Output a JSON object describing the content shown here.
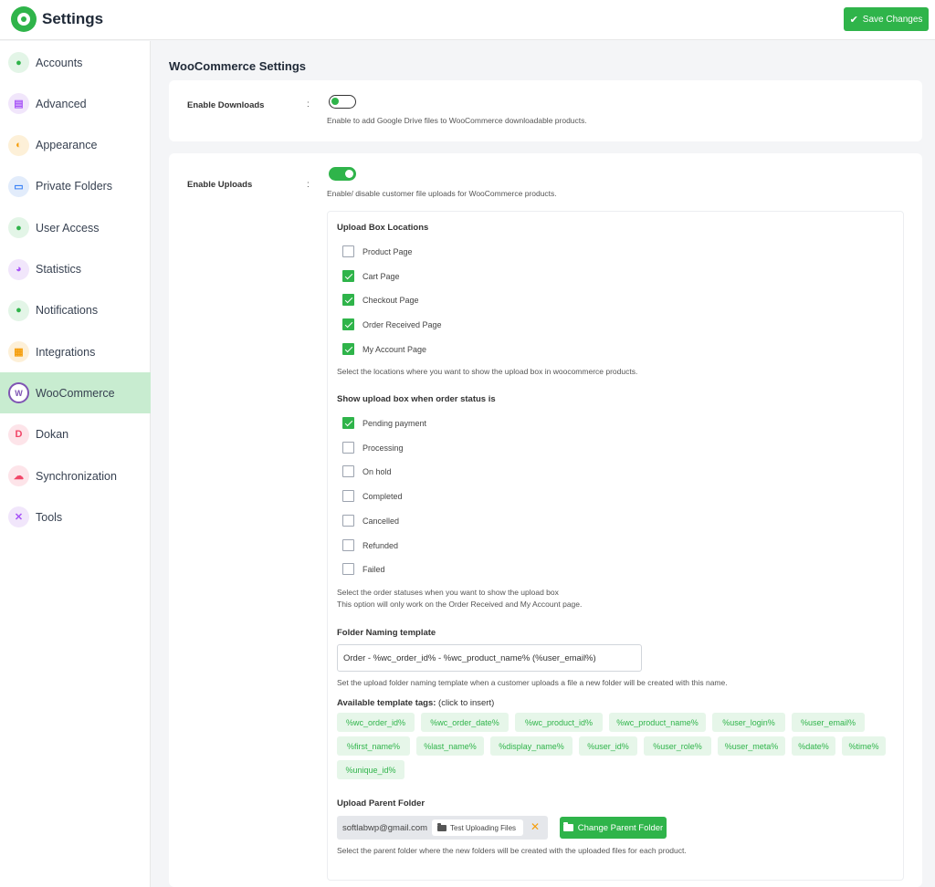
{
  "header": {
    "title": "Settings",
    "save_label": "Save Changes"
  },
  "sidebar": {
    "items": [
      {
        "label": "Accounts",
        "icon": "user-icon",
        "glyph": "●",
        "color": "#2fb44a",
        "bg": "#e3f5e7"
      },
      {
        "label": "Advanced",
        "icon": "sliders-icon",
        "glyph": "▤",
        "color": "#a855f7",
        "bg": "#f1e6fb"
      },
      {
        "label": "Appearance",
        "icon": "palette-icon",
        "glyph": "◐",
        "color": "#f59e0b",
        "bg": "#fdf0d8"
      },
      {
        "label": "Private Folders",
        "icon": "folder-icon",
        "glyph": "▭",
        "color": "#3b82f6",
        "bg": "#e2ecfb"
      },
      {
        "label": "User Access",
        "icon": "user-lock-icon",
        "glyph": "●",
        "color": "#2fb44a",
        "bg": "#e3f5e7"
      },
      {
        "label": "Statistics",
        "icon": "pie-chart-icon",
        "glyph": "◕",
        "color": "#a855f7",
        "bg": "#f1e6fb"
      },
      {
        "label": "Notifications",
        "icon": "bell-icon",
        "glyph": "●",
        "color": "#2fb44a",
        "bg": "#e3f5e7"
      },
      {
        "label": "Integrations",
        "icon": "grid-icon",
        "glyph": "▦",
        "color": "#f59e0b",
        "bg": "#fdf0d8"
      },
      {
        "label": "WooCommerce",
        "icon": "woocommerce-icon",
        "glyph": "W",
        "color": "#7f54b3",
        "bg": "#ffffff",
        "active": true
      },
      {
        "label": "Dokan",
        "icon": "dokan-icon",
        "glyph": "D",
        "color": "#f14668",
        "bg": "#fde4e9"
      },
      {
        "label": "Synchronization",
        "icon": "cloud-sync-icon",
        "glyph": "☁",
        "color": "#f14668",
        "bg": "#fde4e9"
      },
      {
        "label": "Tools",
        "icon": "tools-icon",
        "glyph": "✕",
        "color": "#a855f7",
        "bg": "#f1e6fb"
      }
    ]
  },
  "main": {
    "title": "WooCommerce Settings",
    "downloads": {
      "label": "Enable Downloads",
      "colon": ":",
      "enabled": false,
      "description": "Enable to add Google Drive files to WooCommerce downloadable products."
    },
    "uploads": {
      "label": "Enable Uploads",
      "colon": ":",
      "enabled": true,
      "description": "Enable/ disable customer file uploads for WooCommerce products.",
      "locations_title": "Upload Box Locations",
      "locations": [
        {
          "label": "Product Page",
          "checked": false
        },
        {
          "label": "Cart Page",
          "checked": true
        },
        {
          "label": "Checkout Page",
          "checked": true
        },
        {
          "label": "Order Received Page",
          "checked": true
        },
        {
          "label": "My Account Page",
          "checked": true
        }
      ],
      "locations_desc": "Select the locations where you want to show the upload box in woocommerce products.",
      "status_title": "Show upload box when order status is",
      "statuses": [
        {
          "label": "Pending payment",
          "checked": true
        },
        {
          "label": "Processing",
          "checked": false
        },
        {
          "label": "On hold",
          "checked": false
        },
        {
          "label": "Completed",
          "checked": false
        },
        {
          "label": "Cancelled",
          "checked": false
        },
        {
          "label": "Refunded",
          "checked": false
        },
        {
          "label": "Failed",
          "checked": false
        }
      ],
      "status_desc_1": "Select the order statuses when you want to show the upload box",
      "status_desc_2": "This option will only work on the Order Received and My Account page.",
      "naming_title": "Folder Naming template",
      "naming_value": "Order - %wc_order_id% - %wc_product_name% (%user_email%)",
      "naming_desc": "Set the upload folder naming template when a customer uploads a file a new folder will be created with this name.",
      "tags_title_bold": "Available template tags:",
      "tags_title_rest": " (click to insert)",
      "tags": [
        "%wc_order_id%",
        "%wc_order_date%",
        "%wc_product_id%",
        "%wc_product_name%",
        "%user_login%",
        "%user_email%",
        "%first_name%",
        "%last_name%",
        "%display_name%",
        "%user_id%",
        "%user_role%",
        "%user_meta%",
        "%date%",
        "%time%",
        "%unique_id%"
      ],
      "parent_title": "Upload Parent Folder",
      "parent_email": "softlabwp@gmail.com",
      "parent_folder": "Test Uploading Files",
      "remove_glyph": "✕",
      "change_label": "Change Parent Folder",
      "parent_desc": "Select the parent folder where the new folders will be created with the uploaded files for each product."
    }
  }
}
